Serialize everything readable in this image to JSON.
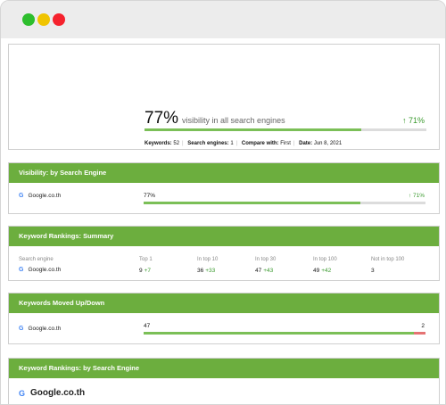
{
  "window": {
    "title": ""
  },
  "summary": {
    "visibility_pct": "77%",
    "visibility_text": "visibility in all search engines",
    "trend": "↑ 71%",
    "visibility_fraction": 0.77,
    "meta": [
      {
        "label": "Keywords:",
        "value": "52"
      },
      {
        "label": "Search engines:",
        "value": "1"
      },
      {
        "label": "Compare with:",
        "value": "First"
      },
      {
        "label": "Date:",
        "value": "Jun 8, 2021"
      }
    ]
  },
  "visibility_card": {
    "title": "Visibility: by Search Engine",
    "engine": "Google.co.th",
    "value": "77%",
    "trend": "↑ 71%",
    "fraction": 0.77
  },
  "rankings_summary": {
    "title": "Keyword Rankings: Summary",
    "headers": [
      "Search engine",
      "Top 1",
      "In top 10",
      "In top 30",
      "In top 100",
      "Not in top 100"
    ],
    "engine": "Google.co.th",
    "values": [
      {
        "value": "9",
        "delta": "+7"
      },
      {
        "value": "36",
        "delta": "+33"
      },
      {
        "value": "47",
        "delta": "+43"
      },
      {
        "value": "49",
        "delta": "+42"
      },
      {
        "value": "3",
        "delta": ""
      }
    ]
  },
  "moved_card": {
    "title": "Keywords Moved Up/Down",
    "engine": "Google.co.th",
    "up": "47",
    "down": "2",
    "up_fraction": 0.959
  },
  "by_engine_card": {
    "title": "Keyword Rankings: by Search Engine",
    "engine": "Google.co.th"
  },
  "icons": {
    "google": "G"
  },
  "colors": {
    "header_green": "#6cae3e",
    "bar_green": "#7bbf57",
    "trend_green": "#3a9a2e",
    "down_red": "#e57373"
  }
}
